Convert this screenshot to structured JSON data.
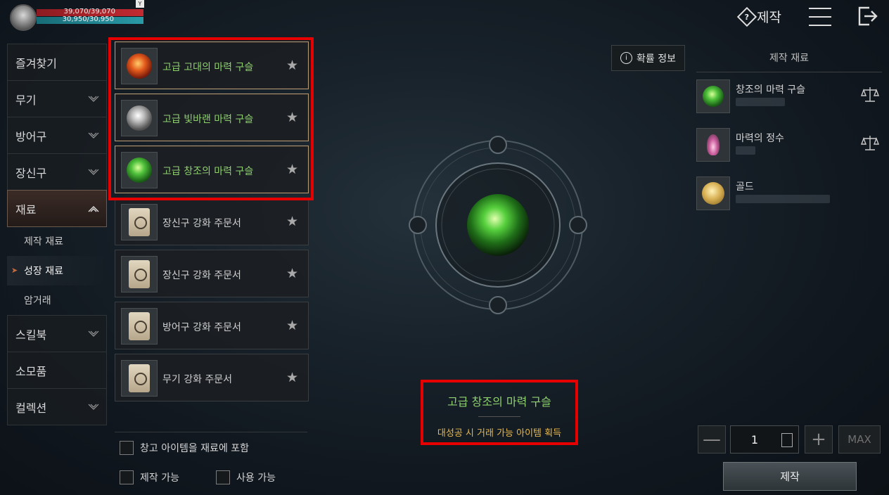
{
  "player": {
    "hp": "39,070/39,070",
    "mp": "30,950/30,950",
    "badge": "Y"
  },
  "header": {
    "title": "제작",
    "help_icon": "help-diamond-icon",
    "menu_icon": "hamburger-menu-icon",
    "exit_icon": "exit-icon"
  },
  "nav": {
    "items": [
      {
        "label": "즐겨찾기"
      },
      {
        "label": "무기"
      },
      {
        "label": "방어구"
      },
      {
        "label": "장신구"
      },
      {
        "label": "재료"
      },
      {
        "label": "스킬북"
      },
      {
        "label": "소모품"
      },
      {
        "label": "컬렉션"
      }
    ],
    "sub_items": [
      {
        "label": "제작 재료"
      },
      {
        "label": "성장 재료"
      },
      {
        "label": "암거래"
      }
    ]
  },
  "list": {
    "items": [
      {
        "name": "고급 고대의 마력 구슬",
        "icon": "red-orb-icon"
      },
      {
        "name": "고급 빛바랜 마력 구슬",
        "icon": "silver-orb-icon"
      },
      {
        "name": "고급 창조의 마력 구슬",
        "icon": "green-orb-icon"
      },
      {
        "name": "장신구 강화 주문서",
        "icon": "scroll-icon"
      },
      {
        "name": "장신구 강화 주문서",
        "icon": "scroll-icon"
      },
      {
        "name": "방어구 강화 주문서",
        "icon": "scroll-icon"
      },
      {
        "name": "무기 강화 주문서",
        "icon": "scroll-icon"
      }
    ],
    "star": "★"
  },
  "filters": {
    "include_storage": "창고 아이템을 재료에 포함",
    "craftable": "제작 가능",
    "usable": "사용 가능"
  },
  "center": {
    "probability_label": "확률 정보",
    "result_name": "고급 창조의 마력 구슬",
    "result_note": "대성공 시 거래 가능 아이템 획득"
  },
  "materials": {
    "title": "제작 재료",
    "items": [
      {
        "name": "창조의 마력 구슬",
        "icon": "green-orb-icon"
      },
      {
        "name": "마력의 정수",
        "icon": "essence-crystal-icon"
      },
      {
        "name": "골드",
        "icon": "gold-coin-icon"
      }
    ]
  },
  "quantity": {
    "value": "1",
    "minus": "—",
    "plus": "+",
    "max_label": "MAX"
  },
  "craft_button": "제작",
  "colors": {
    "accent_green": "#8fd06f",
    "note_yellow": "#e9b94a",
    "annotation_red": "#e60000"
  }
}
